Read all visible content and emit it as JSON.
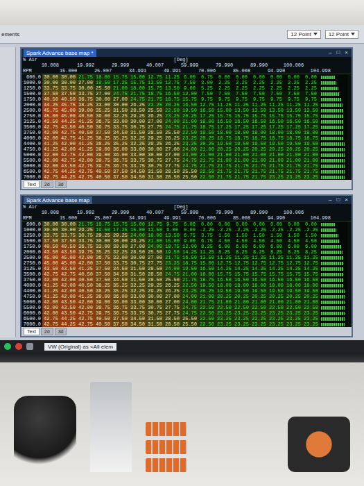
{
  "app": {
    "sidebar_label": "ements",
    "toolbar_fields": [
      "12 Point",
      "12 Point"
    ]
  },
  "windows": [
    {
      "title": "Spark Advance base map *",
      "active": true,
      "controls": [
        "–",
        "□",
        "×"
      ],
      "axis_label": "% Air",
      "row_label": "RPM",
      "unit": "[Deg]",
      "columns": [
        "10.008",
        "15.000",
        "19.992",
        "25.007",
        "29.999",
        "34.991",
        "40.007",
        "49.991",
        "59.999",
        "70.006",
        "79.990",
        "85.008",
        "89.990",
        "94.990",
        "100.006",
        "104.998"
      ],
      "rows": [
        {
          "rpm": "600.0",
          "bar": 0.55,
          "cells": [
            "30.00",
            "30.00",
            "21.75",
            "18.00",
            "15.75",
            "15.00",
            "12.75",
            "11.25",
            "6.00",
            "0.75",
            "0.00",
            "0.00",
            "0.00",
            "0.00",
            "0.00",
            "0.00"
          ]
        },
        {
          "rpm": "1000.0",
          "bar": 0.6,
          "cells": [
            "30.00",
            "30.00",
            "27.00",
            "19.50",
            "17.25",
            "15.75",
            "13.50",
            "12.75",
            "7.50",
            "3.00",
            "2.25",
            "2.25",
            "2.25",
            "2.25",
            "2.25",
            "2.25"
          ]
        },
        {
          "rpm": "1250.0",
          "bar": 0.7,
          "cells": [
            "33.75",
            "33.75",
            "30.00",
            "25.50",
            "21.00",
            "18.00",
            "15.75",
            "13.50",
            "9.00",
            "5.25",
            "2.25",
            "2.25",
            "2.25",
            "2.25",
            "2.25",
            "2.25"
          ]
        },
        {
          "rpm": "1500.0",
          "bar": 0.75,
          "cells": [
            "37.50",
            "37.50",
            "33.75",
            "27.00",
            "24.75",
            "21.75",
            "18.75",
            "16.50",
            "12.00",
            "7.50",
            "7.50",
            "7.50",
            "7.50",
            "7.50",
            "7.50",
            "7.50"
          ]
        },
        {
          "rpm": "1750.0",
          "bar": 0.8,
          "cells": [
            "40.50",
            "40.50",
            "36.75",
            "30.00",
            "27.00",
            "24.75",
            "21.75",
            "18.75",
            "15.75",
            "9.75",
            "9.75",
            "9.75",
            "9.75",
            "9.75",
            "9.75",
            "9.75"
          ]
        },
        {
          "rpm": "2000.0",
          "bar": 0.85,
          "cells": [
            "44.25",
            "45.75",
            "38.25",
            "33.00",
            "30.00",
            "26.25",
            "23.25",
            "20.25",
            "16.50",
            "12.75",
            "11.25",
            "11.25",
            "11.25",
            "11.25",
            "11.25",
            "11.25"
          ]
        },
        {
          "rpm": "2500.0",
          "bar": 0.9,
          "cells": [
            "45.75",
            "45.00",
            "39.00",
            "35.25",
            "31.50",
            "28.50",
            "25.50",
            "22.50",
            "19.50",
            "16.50",
            "15.00",
            "13.50",
            "13.50",
            "13.50",
            "13.50",
            "13.50"
          ]
        },
        {
          "rpm": "2750.0",
          "bar": 0.9,
          "cells": [
            "45.00",
            "45.00",
            "40.50",
            "36.00",
            "32.25",
            "29.25",
            "26.25",
            "23.25",
            "20.25",
            "17.25",
            "15.75",
            "15.75",
            "15.75",
            "15.75",
            "15.75",
            "15.75"
          ]
        },
        {
          "rpm": "3125.0",
          "bar": 0.9,
          "cells": [
            "43.50",
            "44.25",
            "41.25",
            "36.75",
            "33.00",
            "30.00",
            "27.00",
            "24.00",
            "21.00",
            "18.00",
            "16.50",
            "16.50",
            "16.50",
            "16.50",
            "16.50",
            "16.50"
          ]
        },
        {
          "rpm": "3500.0",
          "bar": 0.9,
          "cells": [
            "42.75",
            "43.50",
            "40.50",
            "36.75",
            "33.75",
            "30.75",
            "27.75",
            "24.75",
            "21.75",
            "18.75",
            "17.25",
            "17.25",
            "17.25",
            "17.25",
            "17.25",
            "17.25"
          ]
        },
        {
          "rpm": "3750.0",
          "bar": 0.9,
          "cells": [
            "42.00",
            "42.75",
            "40.50",
            "37.50",
            "34.50",
            "31.50",
            "28.50",
            "25.50",
            "22.50",
            "19.50",
            "18.00",
            "18.00",
            "18.00",
            "18.00",
            "18.00",
            "18.00"
          ]
        },
        {
          "rpm": "4000.0",
          "bar": 0.9,
          "cells": [
            "42.00",
            "42.75",
            "41.25",
            "38.25",
            "35.25",
            "32.25",
            "29.25",
            "26.25",
            "23.25",
            "20.25",
            "18.75",
            "18.75",
            "18.75",
            "18.75",
            "18.75",
            "18.75"
          ]
        },
        {
          "rpm": "4400.0",
          "bar": 0.95,
          "cells": [
            "41.25",
            "42.00",
            "41.25",
            "38.25",
            "35.25",
            "32.25",
            "29.25",
            "26.25",
            "23.25",
            "20.25",
            "19.50",
            "19.50",
            "19.50",
            "19.50",
            "19.50",
            "19.50"
          ]
        },
        {
          "rpm": "4750.0",
          "bar": 0.95,
          "cells": [
            "41.25",
            "42.00",
            "41.25",
            "39.00",
            "36.00",
            "33.00",
            "30.00",
            "27.00",
            "24.00",
            "21.00",
            "20.25",
            "20.25",
            "20.25",
            "20.25",
            "20.25",
            "20.25"
          ]
        },
        {
          "rpm": "5000.0",
          "bar": 0.95,
          "cells": [
            "42.00",
            "42.75",
            "42.00",
            "39.00",
            "36.00",
            "33.00",
            "30.00",
            "27.00",
            "24.00",
            "21.00",
            "21.00",
            "21.00",
            "21.00",
            "21.00",
            "21.00",
            "21.00"
          ]
        },
        {
          "rpm": "5500.0",
          "bar": 0.95,
          "cells": [
            "42.00",
            "42.75",
            "42.00",
            "39.75",
            "36.75",
            "33.75",
            "30.75",
            "27.75",
            "24.75",
            "21.75",
            "21.00",
            "21.00",
            "21.00",
            "21.00",
            "21.00",
            "21.00"
          ]
        },
        {
          "rpm": "6000.0",
          "bar": 0.95,
          "cells": [
            "42.00",
            "43.50",
            "42.75",
            "39.75",
            "36.75",
            "33.75",
            "30.75",
            "27.75",
            "24.75",
            "21.75",
            "21.75",
            "21.75",
            "21.75",
            "21.75",
            "21.75",
            "21.75"
          ]
        },
        {
          "rpm": "6500.0",
          "bar": 0.95,
          "cells": [
            "42.75",
            "44.25",
            "42.75",
            "40.50",
            "37.50",
            "34.50",
            "31.50",
            "28.50",
            "25.50",
            "22.50",
            "21.75",
            "21.75",
            "21.75",
            "21.75",
            "21.75",
            "21.75"
          ]
        },
        {
          "rpm": "7000.0",
          "bar": 0.95,
          "cells": [
            "42.75",
            "44.25",
            "42.75",
            "40.50",
            "37.50",
            "34.50",
            "31.50",
            "28.50",
            "25.50",
            "22.50",
            "21.75",
            "21.75",
            "21.75",
            "23.25",
            "23.25",
            "23.25"
          ]
        }
      ],
      "tabs": [
        {
          "label": "Text",
          "selected": true
        },
        {
          "label": "2d",
          "selected": false
        },
        {
          "label": "3d",
          "selected": false
        }
      ]
    },
    {
      "title": "Spark Advance base map",
      "active": false,
      "controls": [
        "–",
        "□",
        "×"
      ],
      "axis_label": "% Air",
      "row_label": "RPM",
      "unit": "[Deg]",
      "columns": [
        "10.008",
        "15.000",
        "19.992",
        "25.007",
        "29.999",
        "34.991",
        "40.007",
        "49.991",
        "59.999",
        "70.006",
        "79.990",
        "85.008",
        "89.990",
        "94.990",
        "100.006",
        "104.998"
      ],
      "rows": [
        {
          "rpm": "600.0",
          "bar": 0.55,
          "cells": [
            "30.00",
            "30.00",
            "21.75",
            "18.75",
            "15.75",
            "15.00",
            "12.75",
            "9.75",
            "6.00",
            "0.00",
            "0.00",
            "0.00",
            "0.00",
            "0.00",
            "0.00",
            "0.00"
          ]
        },
        {
          "rpm": "1000.0",
          "bar": 0.6,
          "cells": [
            "30.00",
            "30.00",
            "29.25",
            "19.50",
            "17.25",
            "15.00",
            "13.50",
            "6.00",
            "0.00",
            "-2.25",
            "-2.25",
            "-2.25",
            "-2.25",
            "-2.25",
            "-2.25",
            "-2.25"
          ]
        },
        {
          "rpm": "1250.0",
          "bar": 0.7,
          "cells": [
            "33.75",
            "33.75",
            "30.75",
            "29.25",
            "29.25",
            "24.00",
            "18.00",
            "13.50",
            "6.75",
            "3.75",
            "1.50",
            "1.50",
            "1.50",
            "1.50",
            "1.50",
            "1.50"
          ]
        },
        {
          "rpm": "1500.0",
          "bar": 0.75,
          "cells": [
            "37.50",
            "37.50",
            "33.75",
            "30.00",
            "30.00",
            "26.25",
            "21.00",
            "15.00",
            "9.00",
            "6.75",
            "4.50",
            "4.50",
            "4.50",
            "4.50",
            "4.50",
            "4.50"
          ]
        },
        {
          "rpm": "1750.0",
          "bar": 0.8,
          "cells": [
            "40.50",
            "40.50",
            "36.75",
            "33.00",
            "30.00",
            "27.00",
            "24.00",
            "18.75",
            "12.00",
            "8.25",
            "6.00",
            "6.00",
            "6.00",
            "6.00",
            "6.00",
            "6.00"
          ]
        },
        {
          "rpm": "2000.0",
          "bar": 0.85,
          "cells": [
            "43.50",
            "43.50",
            "39.75",
            "35.25",
            "32.25",
            "28.50",
            "25.50",
            "19.50",
            "14.25",
            "11.25",
            "8.25",
            "8.25",
            "8.25",
            "8.25",
            "8.25",
            "8.25"
          ]
        },
        {
          "rpm": "2500.0",
          "bar": 0.9,
          "cells": [
            "45.00",
            "45.00",
            "42.00",
            "36.75",
            "33.00",
            "30.00",
            "27.00",
            "21.75",
            "16.50",
            "13.50",
            "11.25",
            "11.25",
            "11.25",
            "11.25",
            "11.25",
            "11.25"
          ]
        },
        {
          "rpm": "2750.0",
          "bar": 0.9,
          "cells": [
            "45.00",
            "45.00",
            "42.00",
            "37.50",
            "33.75",
            "30.75",
            "27.75",
            "23.25",
            "18.75",
            "15.00",
            "12.75",
            "12.75",
            "12.75",
            "12.75",
            "12.75",
            "12.75"
          ]
        },
        {
          "rpm": "3125.0",
          "bar": 0.9,
          "cells": [
            "43.50",
            "43.50",
            "41.25",
            "37.50",
            "34.50",
            "31.50",
            "28.50",
            "24.00",
            "19.50",
            "16.50",
            "14.25",
            "14.25",
            "14.25",
            "14.25",
            "14.25",
            "14.25"
          ]
        },
        {
          "rpm": "3500.0",
          "bar": 0.9,
          "cells": [
            "42.75",
            "42.75",
            "40.50",
            "37.50",
            "34.50",
            "31.50",
            "28.50",
            "24.75",
            "21.00",
            "18.00",
            "15.75",
            "15.75",
            "15.75",
            "15.75",
            "15.75",
            "15.75"
          ]
        },
        {
          "rpm": "3750.0",
          "bar": 0.9,
          "cells": [
            "42.00",
            "42.00",
            "40.50",
            "37.50",
            "34.50",
            "31.50",
            "28.50",
            "25.50",
            "21.75",
            "18.75",
            "16.50",
            "16.50",
            "16.50",
            "16.50",
            "16.50",
            "16.50"
          ]
        },
        {
          "rpm": "4000.0",
          "bar": 0.9,
          "cells": [
            "41.25",
            "42.00",
            "40.50",
            "38.25",
            "35.25",
            "32.25",
            "29.25",
            "26.25",
            "22.50",
            "19.50",
            "18.00",
            "18.00",
            "18.00",
            "18.00",
            "18.00",
            "18.00"
          ]
        },
        {
          "rpm": "4400.0",
          "bar": 0.95,
          "cells": [
            "41.25",
            "42.00",
            "40.50",
            "38.25",
            "35.25",
            "32.25",
            "29.25",
            "26.25",
            "23.25",
            "20.25",
            "19.50",
            "19.50",
            "19.50",
            "19.50",
            "19.50",
            "19.50"
          ]
        },
        {
          "rpm": "4750.0",
          "bar": 0.95,
          "cells": [
            "41.25",
            "42.00",
            "41.25",
            "39.00",
            "36.00",
            "33.00",
            "30.00",
            "27.00",
            "24.00",
            "21.00",
            "20.25",
            "20.25",
            "20.25",
            "20.25",
            "20.25",
            "20.25"
          ]
        },
        {
          "rpm": "5000.0",
          "bar": 0.95,
          "cells": [
            "42.00",
            "43.50",
            "42.00",
            "39.00",
            "36.00",
            "33.00",
            "30.00",
            "27.00",
            "24.00",
            "21.75",
            "21.00",
            "21.00",
            "21.00",
            "21.00",
            "21.00",
            "21.00"
          ]
        },
        {
          "rpm": "5500.0",
          "bar": 0.95,
          "cells": [
            "42.00",
            "43.50",
            "42.00",
            "39.75",
            "36.75",
            "33.75",
            "30.75",
            "27.75",
            "24.75",
            "22.50",
            "22.50",
            "22.50",
            "22.50",
            "22.50",
            "22.50",
            "22.50"
          ]
        },
        {
          "rpm": "6000.0",
          "bar": 0.95,
          "cells": [
            "42.00",
            "43.50",
            "42.75",
            "39.75",
            "36.75",
            "33.75",
            "30.75",
            "27.75",
            "24.75",
            "22.50",
            "23.25",
            "23.25",
            "23.25",
            "23.25",
            "23.25",
            "23.25"
          ]
        },
        {
          "rpm": "6500.0",
          "bar": 0.95,
          "cells": [
            "42.75",
            "44.25",
            "42.75",
            "40.50",
            "37.50",
            "34.50",
            "31.50",
            "28.50",
            "25.50",
            "22.50",
            "23.25",
            "23.25",
            "23.25",
            "23.25",
            "23.25",
            "23.25"
          ]
        },
        {
          "rpm": "7000.0",
          "bar": 0.95,
          "cells": [
            "42.75",
            "44.25",
            "42.75",
            "40.50",
            "37.50",
            "34.50",
            "31.50",
            "28.50",
            "25.50",
            "22.50",
            "23.25",
            "23.25",
            "23.25",
            "23.25",
            "23.25",
            "23.25"
          ]
        }
      ],
      "tabs": [
        {
          "label": "Text",
          "selected": true
        },
        {
          "label": "2d",
          "selected": false
        },
        {
          "label": "3d",
          "selected": false
        }
      ]
    }
  ],
  "taskbar": {
    "tab_label": "VW (Original) as <All elem"
  }
}
